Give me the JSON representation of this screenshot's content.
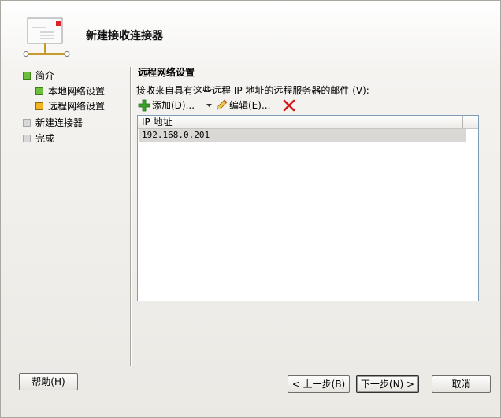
{
  "wizard": {
    "title": "新建接收连接器"
  },
  "nav": {
    "items": [
      {
        "label": "简介",
        "state": "done"
      },
      {
        "label": "本地网络设置",
        "state": "done"
      },
      {
        "label": "远程网络设置",
        "state": "current"
      },
      {
        "label": "新建连接器",
        "state": "pending"
      },
      {
        "label": "完成",
        "state": "pending"
      }
    ]
  },
  "page": {
    "section_title": "远程网络设置",
    "description": "接收来自具有这些远程 IP 地址的远程服务器的邮件 (V):"
  },
  "toolbar": {
    "add_label": "添加(D)...",
    "edit_label": "编辑(E)...",
    "add_icon": "plus-icon",
    "dropdown_icon": "dropdown-arrow-icon",
    "edit_icon": "pencil-icon",
    "delete_icon": "delete-x-icon"
  },
  "table": {
    "columns": [
      "IP 地址"
    ],
    "rows": [
      [
        "192.168.0.201"
      ]
    ]
  },
  "buttons": {
    "help": "帮助(H)",
    "back": "< 上一步(B)",
    "next": "下一步(N) >",
    "cancel": "取消"
  },
  "colors": {
    "done_indicator": "#6cbf3a",
    "current_indicator": "#f0b521",
    "pending_indicator": "#d8d8d8",
    "delete_icon": "#d21b1b",
    "add_icon": "#3aa12b"
  }
}
